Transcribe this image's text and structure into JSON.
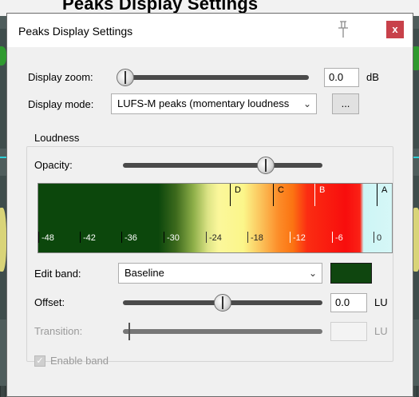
{
  "background": {
    "heading": "Peaks Display Settings"
  },
  "dialog": {
    "title": "Peaks Display Settings",
    "close_label": "x",
    "pin_icon": "pin-icon"
  },
  "display_zoom": {
    "label": "Display zoom:",
    "value": "0.0",
    "unit": "dB"
  },
  "display_mode": {
    "label": "Display mode:",
    "selected": "LUFS-M peaks (momentary loudness",
    "button_label": "..."
  },
  "loudness": {
    "group_label": "Loudness",
    "opacity_label": "Opacity:",
    "meter": {
      "ticks": [
        "-48",
        "-42",
        "-36",
        "-30",
        "-24",
        "-18",
        "-12",
        "-6",
        "0"
      ],
      "bands": [
        "D",
        "C",
        "B",
        "A"
      ]
    },
    "edit_band": {
      "label": "Edit band:",
      "selected": "Baseline",
      "color": "#0f460f"
    },
    "offset": {
      "label": "Offset:",
      "value": "0.0",
      "unit": "LU"
    },
    "transition": {
      "label": "Transition:",
      "value": "",
      "unit": "LU"
    },
    "enable_band": {
      "label": "Enable band",
      "checked": true
    }
  }
}
